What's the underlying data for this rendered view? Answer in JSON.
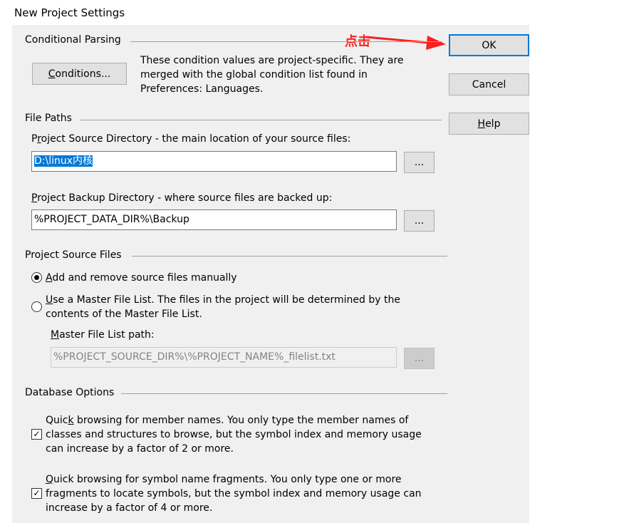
{
  "window": {
    "title": "New Project Settings"
  },
  "buttons": {
    "ok": "OK",
    "cancel": "Cancel",
    "help_prefix": "",
    "help_ul": "H",
    "help_rest": "elp"
  },
  "annotation": {
    "text": "点击",
    "color": "#ff1e1e"
  },
  "conditional": {
    "section": "Conditional Parsing",
    "button_ul": "C",
    "button_rest": "onditions...",
    "desc1": "These condition values are project-specific.  They are",
    "desc2": "merged with the global condition list found in",
    "desc3": "Preferences: Languages."
  },
  "file_paths": {
    "section": "File Paths",
    "source_label_ul": "r",
    "source_label_pre": "P",
    "source_label_post": "oject Source Directory - the main location of your source files:",
    "source_value": "D:\\linux内核",
    "backup_label_pre": "",
    "backup_label_ul": "P",
    "backup_label_post": "roject Backup Directory - where source files are backed up:",
    "backup_value": "%PROJECT_DATA_DIR%\\Backup",
    "browse": "..."
  },
  "source_files": {
    "section": "Project Source Files",
    "opt1_ul": "A",
    "opt1_rest": "dd and remove source files manually",
    "opt2_ul": "U",
    "opt2_rest": "se a Master File List. The files in the project will be determined by the",
    "opt2_line2": "contents of the Master File List.",
    "master_label_ul": "M",
    "master_label_rest": "aster File List path:",
    "master_value": "%PROJECT_SOURCE_DIR%\\%PROJECT_NAME%_filelist.txt",
    "browse": "..."
  },
  "database": {
    "section": "Database Options",
    "c1_pre": "Quic",
    "c1_ul": "k",
    "c1_rest": " browsing for member names.  You only type the member names of",
    "c1_line2": "classes and structures to browse, but the symbol index and memory usage",
    "c1_line3": "can increase by a factor of 2 or more.",
    "c2_ul": "Q",
    "c2_rest": "uick browsing for symbol name fragments.  You only type one or more",
    "c2_line2": "fragments to locate symbols, but the symbol index and memory usage can",
    "c2_line3": "increase by a factor of 4 or more."
  }
}
